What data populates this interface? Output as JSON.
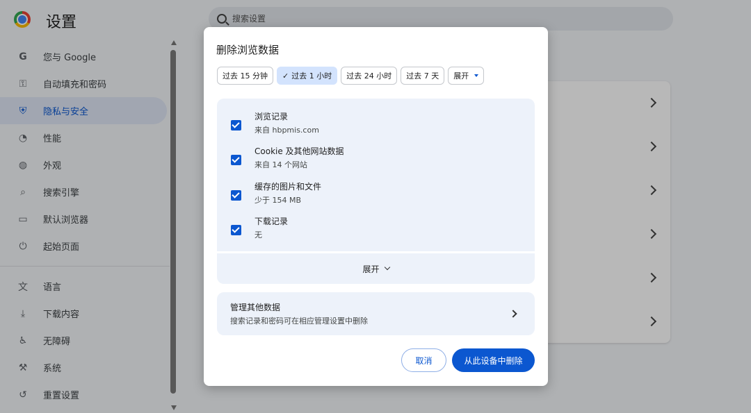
{
  "header": {
    "app_title": "设置",
    "search_placeholder": "搜索设置"
  },
  "sidebar": {
    "items": [
      {
        "label": "您与 Google",
        "icon": "google-g-icon",
        "glyph": "G"
      },
      {
        "label": "自动填充和密码",
        "icon": "key-icon",
        "glyph": "⚿"
      },
      {
        "label": "隐私与安全",
        "icon": "shield-icon",
        "glyph": "⛨",
        "active": true
      },
      {
        "label": "性能",
        "icon": "speedometer-icon",
        "glyph": "◔"
      },
      {
        "label": "外观",
        "icon": "palette-icon",
        "glyph": "◍"
      },
      {
        "label": "搜索引擎",
        "icon": "search-icon",
        "glyph": "⌕"
      },
      {
        "label": "默认浏览器",
        "icon": "browser-window-icon",
        "glyph": "▭"
      },
      {
        "label": "起始页面",
        "icon": "power-icon",
        "glyph": "⏻"
      }
    ],
    "items2": [
      {
        "label": "语言",
        "icon": "translate-icon",
        "glyph": "文"
      },
      {
        "label": "下载内容",
        "icon": "download-icon",
        "glyph": "⤓"
      },
      {
        "label": "无障碍",
        "icon": "accessibility-icon",
        "glyph": "♿"
      },
      {
        "label": "系统",
        "icon": "wrench-icon",
        "glyph": "⚒"
      },
      {
        "label": "重置设置",
        "icon": "reset-icon",
        "glyph": "↺"
      }
    ]
  },
  "dialog": {
    "title": "删除浏览数据",
    "time_ranges": [
      {
        "label": "过去 15 分钟",
        "selected": false
      },
      {
        "label": "过去 1 小时",
        "selected": true
      },
      {
        "label": "过去 24 小时",
        "selected": false
      },
      {
        "label": "过去 7 天",
        "selected": false
      }
    ],
    "more_range_label": "展开",
    "options": [
      {
        "title": "浏览记录",
        "subtitle": "来自 hbpmis.com",
        "checked": true
      },
      {
        "title": "Cookie 及其他网站数据",
        "subtitle": "来自 14 个网站",
        "checked": true
      },
      {
        "title": "缓存的图片和文件",
        "subtitle": "少于 154 MB",
        "checked": true
      },
      {
        "title": "下载记录",
        "subtitle": "无",
        "checked": true
      }
    ],
    "expand_label": "展开",
    "manage": {
      "title": "管理其他数据",
      "subtitle": "搜索记录和密码可在相应管理设置中删除"
    },
    "cancel_label": "取消",
    "delete_label": "从此设备中删除"
  },
  "colors": {
    "accent": "#0b57d0",
    "chip_selected": "#d3e3fd",
    "panel": "#edf2fa"
  }
}
